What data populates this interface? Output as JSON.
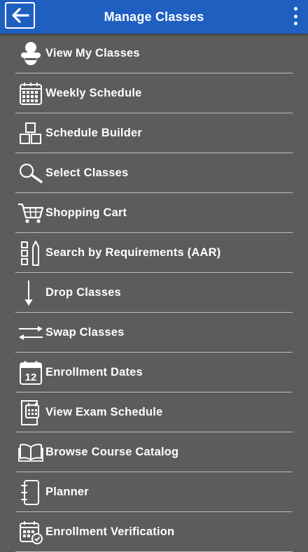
{
  "header": {
    "title": "Manage Classes",
    "back_icon": "arrow-left-icon",
    "menu_icon": "more-vertical-icon",
    "bg_color": "#1f5fc0"
  },
  "menu": {
    "items": [
      {
        "label": "View My Classes",
        "icon": "student-icon"
      },
      {
        "label": "Weekly Schedule",
        "icon": "calendar-grid-icon"
      },
      {
        "label": "Schedule Builder",
        "icon": "blocks-icon"
      },
      {
        "label": "Select Classes",
        "icon": "search-icon"
      },
      {
        "label": "Shopping Cart",
        "icon": "cart-icon"
      },
      {
        "label": "Search by Requirements (AAR)",
        "icon": "checklist-pencil-icon"
      },
      {
        "label": "Drop Classes",
        "icon": "arrow-down-icon"
      },
      {
        "label": "Swap Classes",
        "icon": "swap-arrows-icon"
      },
      {
        "label": "Enrollment Dates",
        "icon": "calendar-date-icon",
        "icon_text": "12"
      },
      {
        "label": "View Exam Schedule",
        "icon": "exam-calendar-icon"
      },
      {
        "label": "Browse Course Catalog",
        "icon": "book-icon"
      },
      {
        "label": "Planner",
        "icon": "notebook-icon"
      },
      {
        "label": "Enrollment Verification",
        "icon": "calendar-check-icon"
      }
    ]
  }
}
